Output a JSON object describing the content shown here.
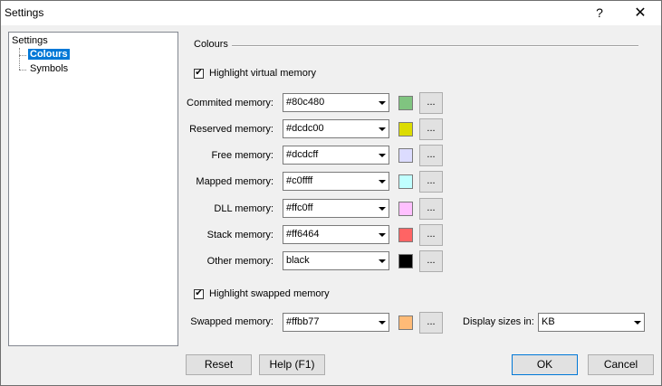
{
  "window": {
    "title": "Settings",
    "help_label": "?",
    "close_label": "✕"
  },
  "tree": {
    "root": "Settings",
    "items": [
      {
        "label": "Colours",
        "selected": true
      },
      {
        "label": "Symbols",
        "selected": false
      }
    ]
  },
  "colours": {
    "group_title": "Colours",
    "highlight_virtual": {
      "label": "Highlight virtual memory",
      "checked": true
    },
    "rows": [
      {
        "label": "Commited memory:",
        "value": "#80c480",
        "color": "#80c480"
      },
      {
        "label": "Reserved memory:",
        "value": "#dcdc00",
        "color": "#dcdc00"
      },
      {
        "label": "Free memory:",
        "value": "#dcdcff",
        "color": "#dcdcff"
      },
      {
        "label": "Mapped memory:",
        "value": "#c0ffff",
        "color": "#c0ffff"
      },
      {
        "label": "DLL memory:",
        "value": "#ffc0ff",
        "color": "#ffc0ff"
      },
      {
        "label": "Stack memory:",
        "value": "#ff6464",
        "color": "#ff6464"
      },
      {
        "label": "Other memory:",
        "value": "black",
        "color": "#000000"
      }
    ],
    "highlight_swapped": {
      "label": "Highlight swapped memory",
      "checked": true
    },
    "swapped": {
      "label": "Swapped memory:",
      "value": "#ffbb77",
      "color": "#ffbb77"
    },
    "display_sizes": {
      "label": "Display sizes in:",
      "value": "KB"
    },
    "more_label": "..."
  },
  "buttons": {
    "reset": "Reset",
    "help": "Help (F1)",
    "ok": "OK",
    "cancel": "Cancel"
  },
  "check_glyph": "✔"
}
